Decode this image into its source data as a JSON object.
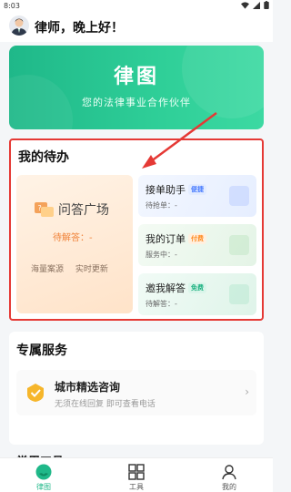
{
  "status_bar": {
    "time": "8:03"
  },
  "greeting": {
    "text": "律师，晚上好！"
  },
  "banner": {
    "title": "律图",
    "subtitle": "您的法律事业合作伙伴"
  },
  "todo": {
    "title": "我的待办",
    "qa_square": {
      "title": "问答广场",
      "status": "待解答：-",
      "tags": [
        "海量案源",
        "实时更新"
      ]
    },
    "cards": [
      {
        "title": "接单助手",
        "badge": "便捷",
        "badge_color": "#4a7dff",
        "badge_bg": "#e3ecff",
        "sub": "待抢单：-"
      },
      {
        "title": "我的订单",
        "badge": "付费",
        "badge_color": "#ff8a1f",
        "badge_bg": "#fff0e0",
        "sub": "服务中：-"
      },
      {
        "title": "邀我解答",
        "badge": "免费",
        "badge_color": "#19b07f",
        "badge_bg": "#dbf5ea",
        "sub": "待解答：-"
      }
    ]
  },
  "service": {
    "title": "专属服务",
    "item": {
      "title": "城市精选咨询",
      "desc": "无须在线回复 即可查看电话"
    }
  },
  "tools_peek": "常用工具",
  "tabbar": {
    "tabs": [
      {
        "label": "律图",
        "icon": "home-icon",
        "active": true
      },
      {
        "label": "工具",
        "icon": "grid-icon",
        "active": false
      },
      {
        "label": "我的",
        "icon": "person-icon",
        "active": false
      }
    ]
  },
  "colors": {
    "accent": "#1fb889",
    "highlight_border": "#e53935",
    "qa_status": "#f0833a"
  }
}
